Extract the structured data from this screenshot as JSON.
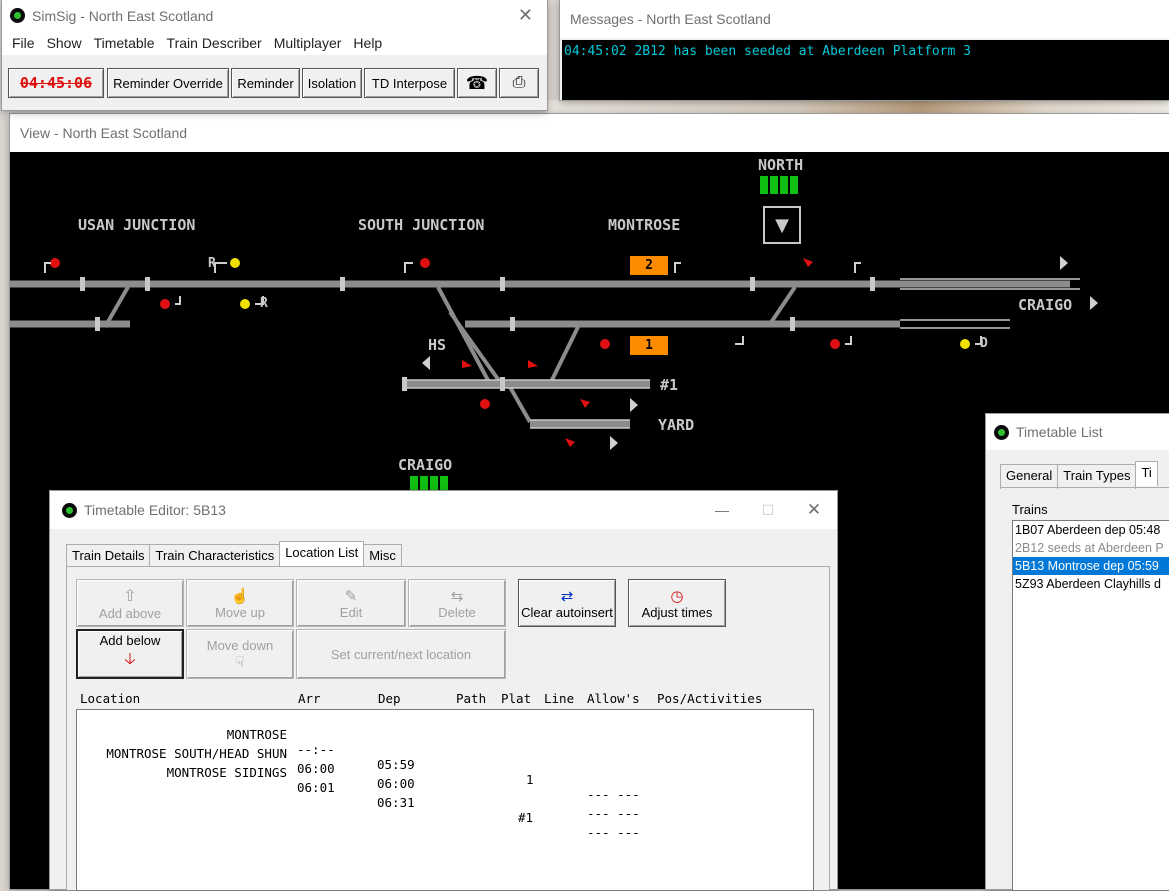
{
  "colors": {
    "track": "#8c8c8c",
    "signal_red": "#e01010",
    "signal_yellow": "#f0e000",
    "berth": "#ff8c00",
    "green_block": "#10c010",
    "messages_text": "#00c8d8",
    "selection": "#0078d7"
  },
  "main_window": {
    "title": "SimSig - North East Scotland",
    "menu": [
      "File",
      "Show",
      "Timetable",
      "Train Describer",
      "Multiplayer",
      "Help"
    ],
    "clock": "04:45:06",
    "toolbar": [
      "Reminder Override",
      "Reminder",
      "Isolation",
      "TD Interpose"
    ],
    "phone_icon": "telephone-icon",
    "printer_icon": "printer-icon"
  },
  "messages": {
    "title": "Messages - North East Scotland",
    "lines": [
      "04:45:02 2B12 has been seeded at Aberdeen Platform 3"
    ]
  },
  "view": {
    "title": "View - North East Scotland",
    "labels": {
      "north": "NORTH",
      "usan": "USAN JUNCTION",
      "south_jn": "SOUTH JUNCTION",
      "montrose": "MONTROSE",
      "craigo_right": "CRAIGO",
      "hs": "HS",
      "siding1": "#1",
      "yard": "YARD",
      "craigo_bottom": "CRAIGO",
      "r1": "R",
      "r2": "R",
      "d": "D"
    },
    "berths": {
      "platform2": "2",
      "platform1": "1"
    }
  },
  "timetable_editor": {
    "title": "Timetable Editor: 5B13",
    "tabs": [
      "Train Details",
      "Train Characteristics",
      "Location List",
      "Misc"
    ],
    "buttons": {
      "add_above": "Add above",
      "move_up": "Move up",
      "edit": "Edit",
      "delete": "Delete",
      "clear_autoinsert": "Clear autoinsert",
      "adjust_times": "Adjust times",
      "add_below": "Add below",
      "move_down": "Move down",
      "set_current": "Set current/next location"
    },
    "columns": [
      "Location",
      "Arr",
      "Dep",
      "Path",
      "Plat",
      "Line",
      "Allow's",
      "Pos/Activities"
    ],
    "rows": [
      {
        "location": "MONTROSE",
        "arr": "--:--",
        "dep": "05:59",
        "plat": "1",
        "allow": "--- ---"
      },
      {
        "location": "MONTROSE SOUTH/HEAD SHUN",
        "arr": "06:00",
        "dep": "06:00",
        "plat": "",
        "allow": "--- ---"
      },
      {
        "location": "MONTROSE SIDINGS",
        "arr": "06:01",
        "dep": "06:31",
        "plat": "#1",
        "allow": "--- ---"
      }
    ]
  },
  "timetable_list": {
    "title": "Timetable List",
    "tabs": [
      "General",
      "Train Types",
      "Ti"
    ],
    "trains_label": "Trains",
    "items": [
      "1B07 Aberdeen dep 05:48",
      "2B12 seeds at Aberdeen P",
      "5B13 Montrose dep 05:59",
      "5Z93 Aberdeen Clayhills d"
    ]
  }
}
